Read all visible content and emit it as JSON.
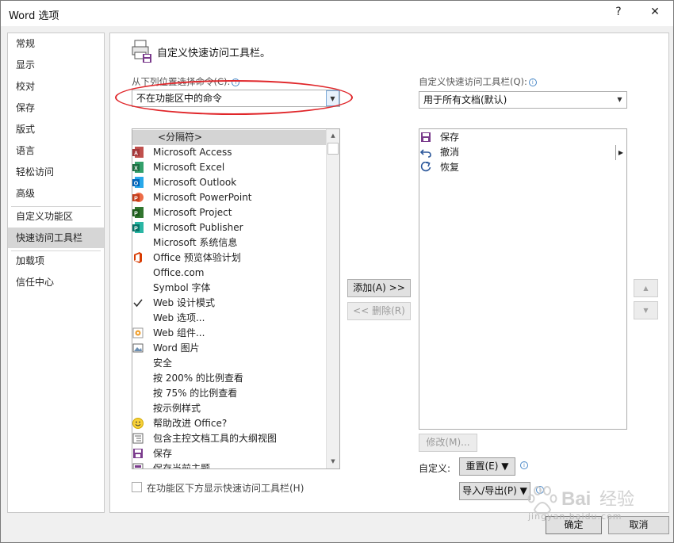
{
  "window": {
    "title": "Word 选项",
    "help": "?",
    "close": "✕"
  },
  "sidebar": {
    "items": [
      {
        "label": "常规"
      },
      {
        "label": "显示"
      },
      {
        "label": "校对"
      },
      {
        "label": "保存"
      },
      {
        "label": "版式"
      },
      {
        "label": "语言"
      },
      {
        "label": "轻松访问"
      },
      {
        "label": "高级"
      },
      {
        "label": "自定义功能区"
      },
      {
        "label": "快速访问工具栏"
      },
      {
        "label": "加载项"
      },
      {
        "label": "信任中心"
      }
    ],
    "selected": "快速访问工具栏"
  },
  "header": {
    "title": "自定义快速访问工具栏。"
  },
  "left": {
    "choose_label": "从下列位置选择命令(C):",
    "choose_value": "不在功能区中的命令",
    "commands": [
      {
        "label": "<分隔符>",
        "icon": "separator"
      },
      {
        "label": "Microsoft Access",
        "icon": "access-icon"
      },
      {
        "label": "Microsoft Excel",
        "icon": "excel-icon"
      },
      {
        "label": "Microsoft Outlook",
        "icon": "outlook-icon"
      },
      {
        "label": "Microsoft PowerPoint",
        "icon": "powerpoint-icon"
      },
      {
        "label": "Microsoft Project",
        "icon": "project-icon"
      },
      {
        "label": "Microsoft Publisher",
        "icon": "publisher-icon"
      },
      {
        "label": "Microsoft 系统信息",
        "icon": ""
      },
      {
        "label": "Office 预览体验计划",
        "icon": "office-icon"
      },
      {
        "label": "Office.com",
        "icon": ""
      },
      {
        "label": "Symbol 字体",
        "icon": ""
      },
      {
        "label": "Web 设计模式",
        "icon": "check-icon"
      },
      {
        "label": "Web 选项...",
        "icon": ""
      },
      {
        "label": "Web 组件...",
        "icon": "web-component-icon"
      },
      {
        "label": "Word 图片",
        "icon": "picture-icon"
      },
      {
        "label": "安全",
        "icon": ""
      },
      {
        "label": "按 200% 的比例查看",
        "icon": ""
      },
      {
        "label": "按 75% 的比例查看",
        "icon": ""
      },
      {
        "label": "按示例样式",
        "icon": ""
      },
      {
        "label": "帮助改进 Office?",
        "icon": "smiley-icon"
      },
      {
        "label": "包含主控文档工具的大纲视图",
        "icon": "outline-icon"
      },
      {
        "label": "保存",
        "icon": "save-icon"
      },
      {
        "label": "保存当前主题",
        "icon": "theme-icon"
      }
    ],
    "show_below_label": "在功能区下方显示快速访问工具栏(H)"
  },
  "right": {
    "customize_label": "自定义快速访问工具栏(Q):",
    "customize_value": "用于所有文档(默认)",
    "items": [
      {
        "label": "保存",
        "icon": "save-icon"
      },
      {
        "label": "撤消",
        "icon": "undo-icon"
      },
      {
        "label": "恢复",
        "icon": "redo-icon"
      }
    ],
    "modify_label": "修改(M)...",
    "custom_label": "自定义:",
    "reset_label": "重置(E) ▼",
    "import_export_label": "导入/导出(P) ▼"
  },
  "middle": {
    "add_label": "添加(A) >>",
    "remove_label": "<< 删除(R)"
  },
  "footer": {
    "ok_label": "确定",
    "cancel_label": "取消"
  },
  "watermark": {
    "text": "jingyan.baidu.com"
  },
  "colors": {
    "red_highlight": "#e0262a",
    "selection": "#d6d6d6",
    "accent": "#2b579a"
  }
}
